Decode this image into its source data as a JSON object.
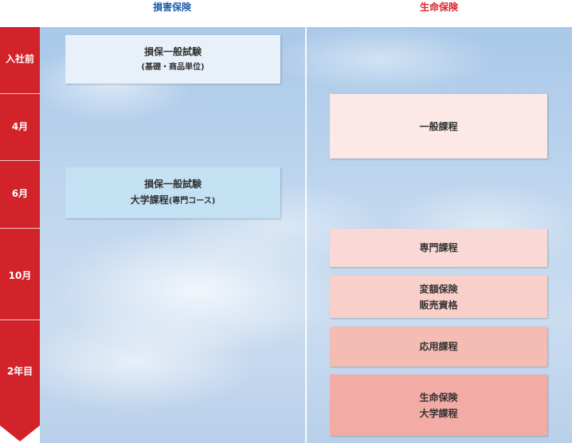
{
  "columns": {
    "nonlife": "損害保険",
    "life": "生命保険"
  },
  "periods": [
    "入社前",
    "4月",
    "6月",
    "10月",
    "2年目"
  ],
  "nonlife_boxes": [
    {
      "line1": "損保一般試験",
      "line2": "(基礎・商品単位)",
      "color": "#e8f1fa"
    },
    {
      "line1": "損保一般試験",
      "line2": "大学課程",
      "line2_sub": "(専門コース)",
      "color": "#c3e1f3"
    }
  ],
  "life_boxes": [
    {
      "line1": "一般課程",
      "color": "#fbe8e7"
    },
    {
      "line1": "専門課程",
      "color": "#f9d9d6"
    },
    {
      "line1": "変額保険",
      "line2": "販売資格",
      "color": "#f8cfc9"
    },
    {
      "line1": "応用課程",
      "color": "#f5bcb4"
    },
    {
      "line1": "生命保険",
      "line2": "大学課程",
      "color": "#f3aba6"
    }
  ],
  "colors": {
    "period_bar": "#d2222a",
    "nonlife_header": "#1e5fa8",
    "life_header": "#d8262b"
  }
}
